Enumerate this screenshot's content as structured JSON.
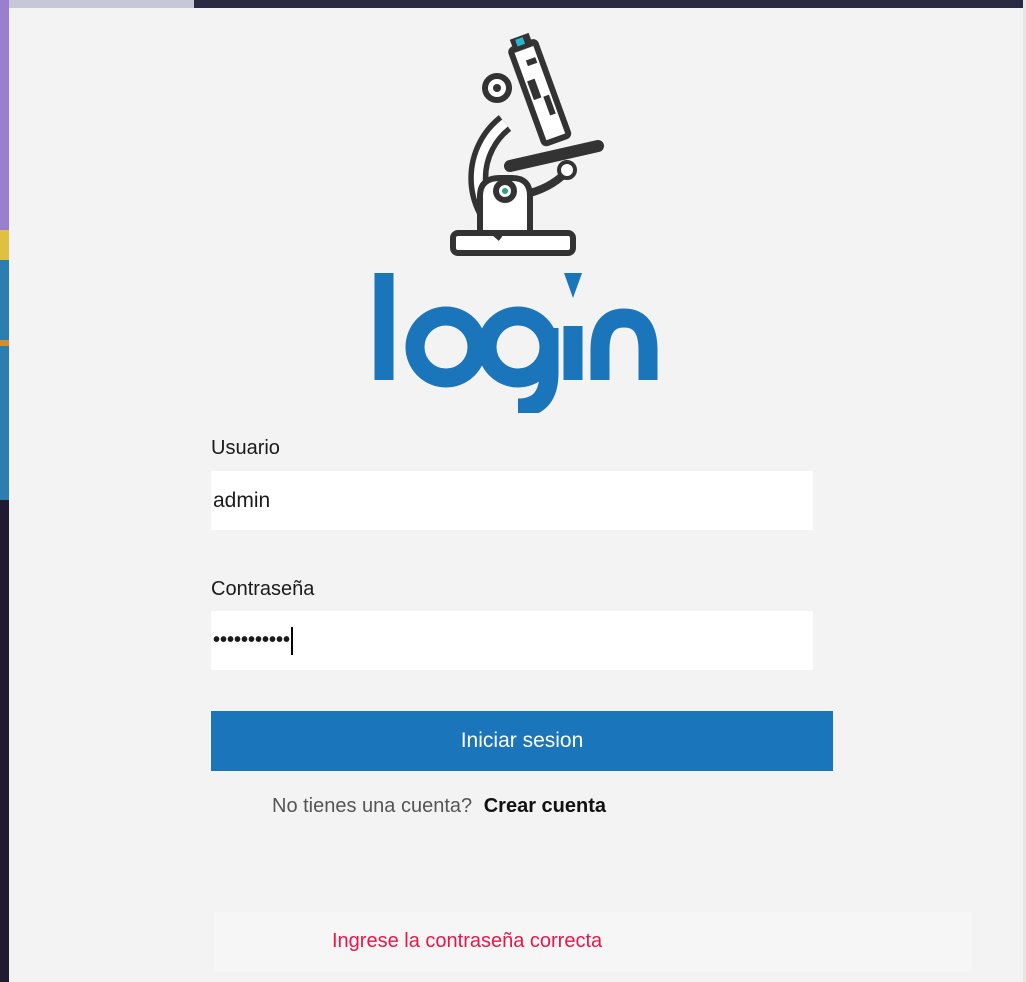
{
  "logo": {
    "icon": "microscope-icon",
    "wordmark": "login",
    "brand_color": "#1a75bb"
  },
  "form": {
    "username_label": "Usuario",
    "username_value": "admin",
    "password_label": "Contraseña",
    "password_masked": "•••••••••••",
    "submit_label": "Iniciar sesion",
    "signup_question": "No tienes una cuenta?",
    "signup_link": "Crear cuenta"
  },
  "status": {
    "error_message": "Ingrese la contraseña correcta",
    "error_color": "#e8174a"
  }
}
